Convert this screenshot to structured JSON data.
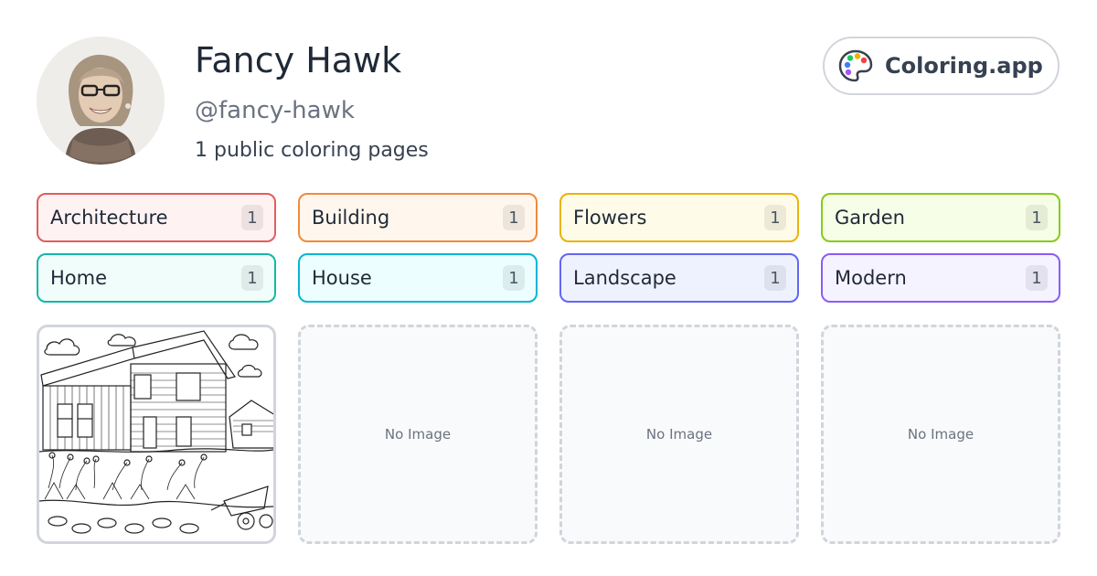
{
  "profile": {
    "name": "Fancy Hawk",
    "handle": "@fancy-hawk",
    "count_text": "1 public coloring pages"
  },
  "brand": {
    "label": "Coloring.app",
    "icon": "palette-icon"
  },
  "tags": [
    {
      "label": "Architecture",
      "count": "1",
      "border": "#e35d5d",
      "bg": "#fef2f2"
    },
    {
      "label": "Building",
      "count": "1",
      "border": "#f08a3c",
      "bg": "#fff7ed"
    },
    {
      "label": "Flowers",
      "count": "1",
      "border": "#eab308",
      "bg": "#fefce8"
    },
    {
      "label": "Garden",
      "count": "1",
      "border": "#84cc16",
      "bg": "#f7fee7"
    },
    {
      "label": "Home",
      "count": "1",
      "border": "#14b8a6",
      "bg": "#f0fdfa"
    },
    {
      "label": "House",
      "count": "1",
      "border": "#06b6d4",
      "bg": "#ecfeff"
    },
    {
      "label": "Landscape",
      "count": "1",
      "border": "#6366f1",
      "bg": "#eef2ff"
    },
    {
      "label": "Modern",
      "count": "1",
      "border": "#8b5cf6",
      "bg": "#f5f3ff"
    }
  ],
  "cards": {
    "placeholder_text": "No Image"
  }
}
